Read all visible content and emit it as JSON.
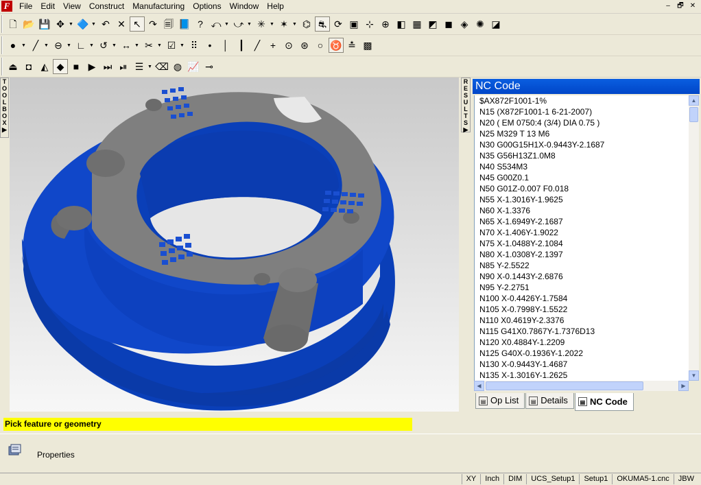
{
  "menu": [
    "File",
    "Edit",
    "View",
    "Construct",
    "Manufacturing",
    "Options",
    "Window",
    "Help"
  ],
  "window_controls": [
    "–",
    "🗗",
    "✕"
  ],
  "toolbars": {
    "row1": [
      {
        "name": "new-file-icon",
        "glyph": "🗋"
      },
      {
        "name": "open-folder-icon",
        "glyph": "📂"
      },
      {
        "name": "save-icon",
        "glyph": "💾"
      },
      {
        "name": "move-icon",
        "glyph": "✥",
        "dd": true
      },
      {
        "name": "view-icon",
        "glyph": "🔷",
        "dd": true
      },
      {
        "name": "undo-icon",
        "glyph": "↶"
      },
      {
        "name": "delete-icon",
        "glyph": "✕"
      },
      {
        "name": "select-arrow-icon",
        "glyph": "↖",
        "pressed": true
      },
      {
        "name": "redo-icon",
        "glyph": "↷"
      },
      {
        "name": "print-icon",
        "glyph": "🗐"
      },
      {
        "name": "help-book-icon",
        "glyph": "📘"
      },
      {
        "name": "help-icon",
        "glyph": "?"
      },
      {
        "name": "curve-icon",
        "glyph": "⤺",
        "dd": true
      },
      {
        "name": "arc-icon",
        "glyph": "⤻",
        "dd": true
      },
      {
        "name": "snap-icon",
        "glyph": "✳",
        "dd": true
      },
      {
        "name": "snap-grid-icon",
        "glyph": "✶",
        "dd": true
      },
      {
        "name": "tool-path-icon",
        "glyph": "⌬"
      },
      {
        "name": "toolpath-show-icon",
        "glyph": "⛐",
        "pressed": true
      },
      {
        "name": "simulate-icon",
        "glyph": "⟳"
      },
      {
        "name": "stock-icon",
        "glyph": "▣"
      },
      {
        "name": "ucs-icon",
        "glyph": "⊹"
      },
      {
        "name": "axis-icon",
        "glyph": "⊕"
      },
      {
        "name": "view-3d-icon",
        "glyph": "◧"
      },
      {
        "name": "mesh-icon",
        "glyph": "▦"
      },
      {
        "name": "surface-icon",
        "glyph": "◩"
      },
      {
        "name": "solid-icon",
        "glyph": "◼"
      },
      {
        "name": "color-icon",
        "glyph": "◈"
      },
      {
        "name": "explode-icon",
        "glyph": "✺"
      },
      {
        "name": "plugin-icon",
        "glyph": "◪"
      }
    ],
    "row2": [
      {
        "name": "point-icon",
        "glyph": "●",
        "dd": true
      },
      {
        "name": "line-icon",
        "glyph": "╱",
        "dd": true
      },
      {
        "name": "circle-icon",
        "glyph": "⊖",
        "dd": true
      },
      {
        "name": "corner-icon",
        "glyph": "∟",
        "dd": true
      },
      {
        "name": "arc-draw-icon",
        "glyph": "↺",
        "dd": true
      },
      {
        "name": "dimension-icon",
        "glyph": "↔",
        "dd": true
      },
      {
        "name": "trim-icon",
        "glyph": "✂",
        "dd": true
      },
      {
        "name": "checkbox-icon",
        "glyph": "☑",
        "dd": true
      },
      {
        "name": "grid-dots-icon",
        "glyph": "⠿"
      },
      {
        "name": "dot-icon",
        "glyph": "•"
      },
      {
        "name": "vertical-line-icon",
        "glyph": "│"
      },
      {
        "name": "vertical-red-icon",
        "glyph": "┃"
      },
      {
        "name": "diagonal-icon",
        "glyph": "╱"
      },
      {
        "name": "crosshair-icon",
        "glyph": "+"
      },
      {
        "name": "target-icon",
        "glyph": "⊙"
      },
      {
        "name": "center-point-icon",
        "glyph": "⊛"
      },
      {
        "name": "ring-icon",
        "glyph": "○"
      },
      {
        "name": "snap-mode-icon",
        "glyph": "♉",
        "pressed": true
      },
      {
        "name": "snap-filter-icon",
        "glyph": "≛"
      },
      {
        "name": "grid-toggle-icon",
        "glyph": "▩"
      }
    ],
    "row3": [
      {
        "name": "eject-icon",
        "glyph": "⏏"
      },
      {
        "name": "concentric-square-icon",
        "glyph": "◘"
      },
      {
        "name": "pocket-icon",
        "glyph": "◭"
      },
      {
        "name": "sim-toggle-icon",
        "glyph": "◆",
        "pressed": true
      },
      {
        "name": "stop-icon",
        "glyph": "■"
      },
      {
        "name": "play-icon",
        "glyph": "▶"
      },
      {
        "name": "fast-forward-icon",
        "glyph": "⏭"
      },
      {
        "name": "step-end-icon",
        "glyph": "⏯"
      },
      {
        "name": "step-list-icon",
        "glyph": "☰",
        "dd": true
      },
      {
        "name": "eraser-icon",
        "glyph": "⌫"
      },
      {
        "name": "shaded-sphere-icon",
        "glyph": "◍"
      },
      {
        "name": "chart-icon",
        "glyph": "📈"
      },
      {
        "name": "probe-icon",
        "glyph": "⊸"
      }
    ]
  },
  "toolbox_label": "TOOLBOX",
  "results_label": "RESULTS",
  "nc_panel": {
    "title": "NC Code",
    "lines": [
      "$AX872F1001-1%",
      "N15 (X872F1001-1  6-21-2007)",
      "N20 ( EM 0750:4 (3/4)    DIA 0.75 )",
      "N25 M329 T 13 M6",
      "N30 G00G15H1X-0.9443Y-2.1687",
      "N35 G56H13Z1.0M8",
      "N40 S534M3",
      "N45 G00Z0.1",
      "N50 G01Z-0.007 F0.018",
      "N55 X-1.3016Y-1.9625",
      "N60 X-1.3376",
      "N65 X-1.6949Y-2.1687",
      "N70 X-1.406Y-1.9022",
      "N75 X-1.0488Y-2.1084",
      "N80 X-1.0308Y-2.1397",
      "N85 Y-2.5522",
      "N90 X-0.1443Y-2.6876",
      "N95 Y-2.2751",
      "N100 X-0.4426Y-1.7584",
      "N105 X-0.7998Y-1.5522",
      "N110 X0.4619Y-2.3376",
      "N115 G41X0.7867Y-1.7376D13",
      "N120 X0.4884Y-1.2209",
      "N125 G40X-0.1936Y-1.2022",
      "N130 X-0.9443Y-1.4687",
      "N135 X-1.3016Y-1.2625"
    ],
    "tabs": [
      {
        "label": "Op List",
        "icon": "op-list-icon"
      },
      {
        "label": "Details",
        "icon": "details-icon"
      },
      {
        "label": "NC Code",
        "icon": "nc-code-icon",
        "active": true
      }
    ]
  },
  "prompt": "Pick feature or geometry",
  "properties_label": "Properties",
  "status_bar": [
    "XY",
    "Inch",
    "DIM",
    "UCS_Setup1",
    "Setup1",
    "OKUMA5-1.cnc",
    "JBW"
  ],
  "colors": {
    "part_blue": "#0a3fb8",
    "part_gray": "#7f7f7f",
    "header_blue": "#0a5ee0",
    "prompt_yellow": "#ffff00"
  }
}
